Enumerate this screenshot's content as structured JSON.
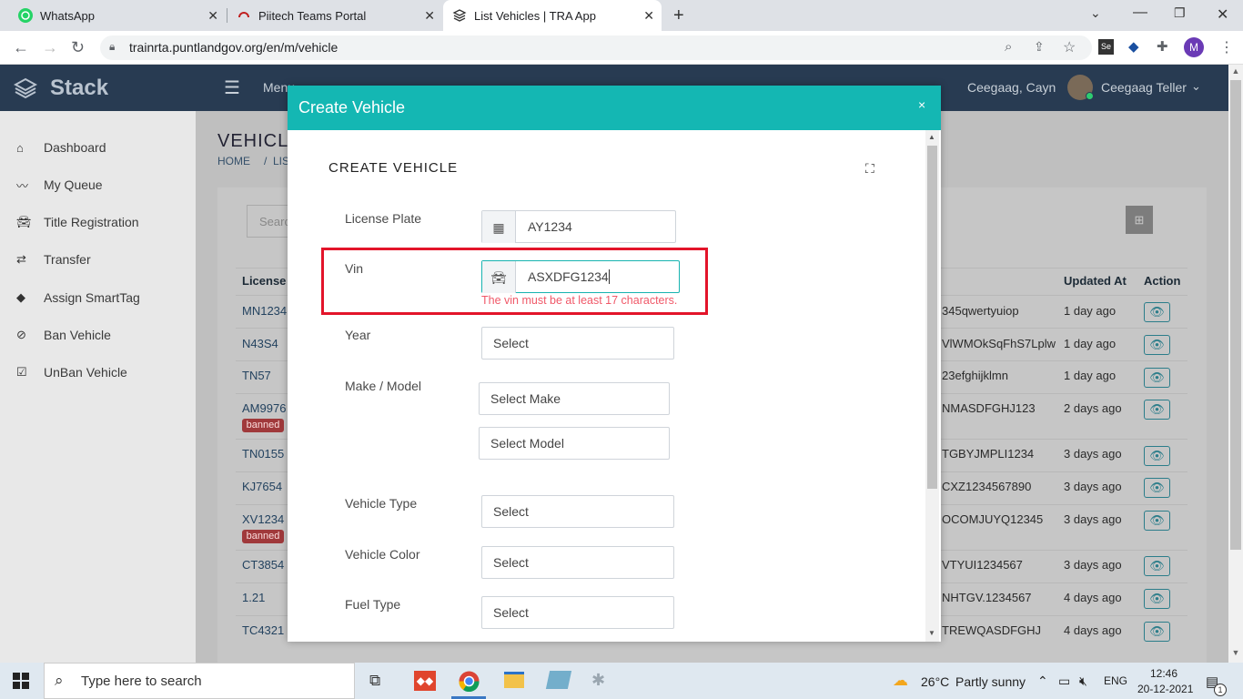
{
  "browser": {
    "tabs": [
      {
        "label": "WhatsApp",
        "icon": "whatsapp-icon"
      },
      {
        "label": "Piitech Teams Portal",
        "icon": "headset-icon"
      },
      {
        "label": "List Vehicles | TRA App",
        "icon": "layers-icon"
      }
    ],
    "url": "trainrta.puntlandgov.org/en/m/vehicle",
    "profile_initial": "M"
  },
  "app": {
    "brand": "Stack",
    "menu_label": "Menu",
    "user_name": "Ceegaag, Cayn",
    "user_role": "Ceegaag Teller"
  },
  "sidebar": {
    "items": [
      {
        "label": "Dashboard",
        "icon": "home-icon"
      },
      {
        "label": "My Queue",
        "icon": "trend-icon"
      },
      {
        "label": "Title Registration",
        "icon": "car-icon"
      },
      {
        "label": "Transfer",
        "icon": "transfer-icon"
      },
      {
        "label": "Assign SmartTag",
        "icon": "tag-icon"
      },
      {
        "label": "Ban Vehicle",
        "icon": "ban-icon"
      },
      {
        "label": "UnBan Vehicle",
        "icon": "checkbox-icon"
      }
    ]
  },
  "page": {
    "title": "VEHICL",
    "breadcrumb_home": "HOME",
    "breadcrumb_sep": "/",
    "breadcrumb_current": "LIS",
    "search_placeholder": "Searc",
    "table_headers": {
      "license": "License",
      "updated": "Updated At",
      "action": "Action"
    },
    "rows": [
      {
        "license": "MN1234",
        "vin": "345qwertyuiop",
        "updated": "1 day ago",
        "banned": false
      },
      {
        "license": "N43S4",
        "vin": "VlWMOkSqFhS7Lplw",
        "updated": "1 day ago",
        "banned": false
      },
      {
        "license": "TN57",
        "vin": "23efghijklmn",
        "updated": "1 day ago",
        "banned": false
      },
      {
        "license": "AM9976",
        "vin": "NMASDFGHJ123",
        "updated": "2 days ago",
        "banned": true
      },
      {
        "license": "TN0155",
        "vin": "TGBYJMPLI1234",
        "updated": "3 days ago",
        "banned": false
      },
      {
        "license": "KJ7654",
        "vin": "CXZ1234567890",
        "updated": "3 days ago",
        "banned": false
      },
      {
        "license": "XV1234",
        "vin": "OCOMJUYQ12345",
        "updated": "3 days ago",
        "banned": true
      },
      {
        "license": "CT3854",
        "vin": "VTYUI1234567",
        "updated": "3 days ago",
        "banned": false
      },
      {
        "license": "1.21",
        "vin": "NHTGV.1234567",
        "updated": "4 days ago",
        "banned": false
      },
      {
        "license": "TC4321",
        "vin": "TREWQASDFGHJ",
        "updated": "4 days ago",
        "banned": false
      }
    ],
    "banned_label": "banned"
  },
  "modal": {
    "title": "Create Vehicle",
    "close": "×",
    "section_title": "CREATE VEHICLE",
    "fields": {
      "license_plate": {
        "label": "License Plate",
        "value": "AY1234"
      },
      "vin": {
        "label": "Vin",
        "value": "ASXDFG1234",
        "error": "The vin must be at least 17 characters."
      },
      "year": {
        "label": "Year",
        "value": "Select"
      },
      "make_model": {
        "label": "Make / Model",
        "make": "Select Make",
        "model": "Select Model"
      },
      "vehicle_type": {
        "label": "Vehicle Type",
        "value": "Select"
      },
      "vehicle_color": {
        "label": "Vehicle Color",
        "value": "Select"
      },
      "fuel_type": {
        "label": "Fuel Type",
        "value": "Select"
      }
    }
  },
  "taskbar": {
    "search_placeholder": "Type here to search",
    "weather_temp": "26°C",
    "weather_desc": "Partly sunny",
    "language": "ENG",
    "time": "12:46",
    "date": "20-12-2021",
    "notification_count": "1"
  },
  "colors": {
    "modal_header": "#14b7b3",
    "error": "#e3142a",
    "app_header": "#283b52"
  }
}
